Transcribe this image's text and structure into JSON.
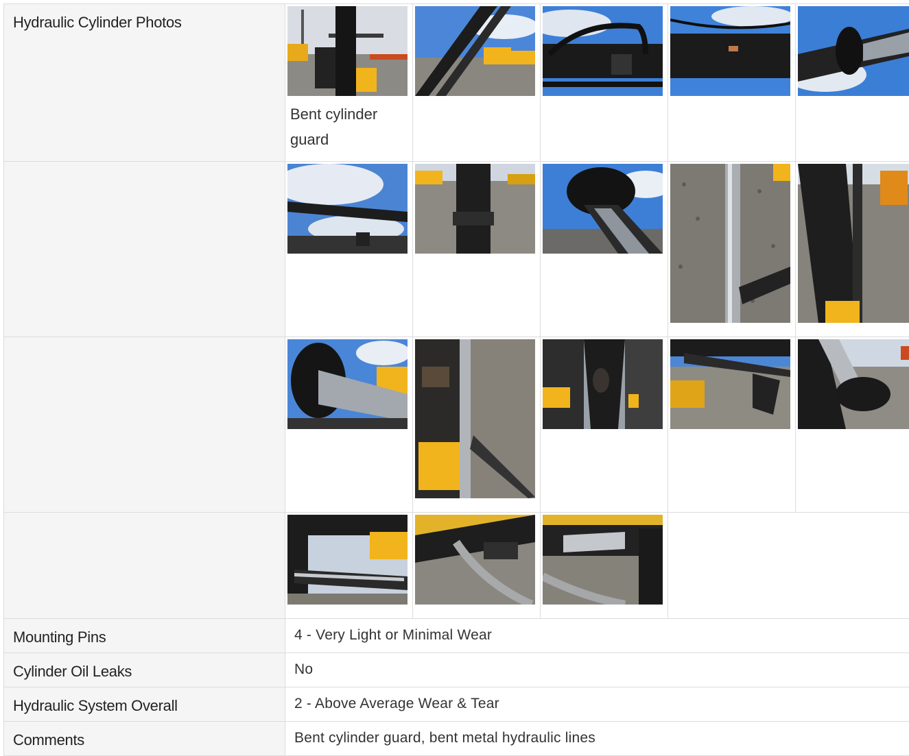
{
  "section": {
    "photos_label": "Hydraulic Cylinder Photos",
    "photo_caption": "Bent cylinder guard"
  },
  "photos": [
    {
      "name": "excavator-front-view-photo"
    },
    {
      "name": "boom-cylinder-sky-photo"
    },
    {
      "name": "cylinder-hose-fitting-photo"
    },
    {
      "name": "bent-guard-closeup-photo"
    },
    {
      "name": "cylinder-rod-end-photo"
    },
    {
      "name": "cylinder-under-sky-photo"
    },
    {
      "name": "dozer-blade-cylinder-photo"
    },
    {
      "name": "cylinder-seal-closeup-photo"
    },
    {
      "name": "cylinder-rod-gravel-photo"
    },
    {
      "name": "arm-cylinder-gravel-photo"
    },
    {
      "name": "cylinder-gland-water-photo"
    },
    {
      "name": "bucket-cylinder-rod-photo"
    },
    {
      "name": "boom-foot-patch-photo"
    },
    {
      "name": "arm-boom-side-photo"
    },
    {
      "name": "cylinder-barrel-yard-photo"
    },
    {
      "name": "swing-cylinder-photo"
    },
    {
      "name": "blade-cylinder-hose-photo"
    },
    {
      "name": "blade-cylinder-rod-photo"
    }
  ],
  "rows": [
    {
      "label": "Mounting Pins",
      "value": "4 - Very Light or Minimal Wear"
    },
    {
      "label": "Cylinder Oil Leaks",
      "value": "No"
    },
    {
      "label": "Hydraulic System Overall",
      "value": "2 - Above Average Wear & Tear"
    },
    {
      "label": "Comments",
      "value": "Bent cylinder guard, bent metal hydraulic lines"
    }
  ],
  "colors": {
    "label_bg": "#f5f5f5",
    "border": "#dcdcdc",
    "machine_yellow": "#f2b41c",
    "steel_black": "#1c1c1c",
    "sky_blue": "#3d7fd6",
    "gravel_gray": "#8a8780"
  }
}
